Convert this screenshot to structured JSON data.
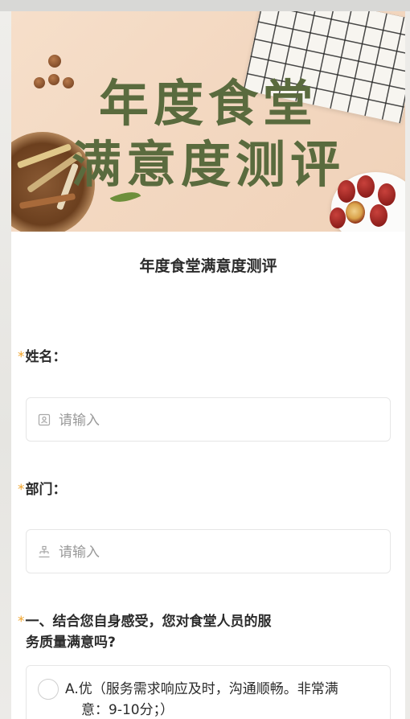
{
  "banner": {
    "title_line1": "年度食堂",
    "title_line2": "满意度测评"
  },
  "form": {
    "title": "年度食堂满意度测评",
    "required_mark": "*",
    "fields": [
      {
        "label": "姓名：",
        "placeholder": "请输入",
        "icon": "user-card-icon"
      },
      {
        "label": "部门：",
        "placeholder": "请输入",
        "icon": "org-chart-icon"
      }
    ],
    "question1": {
      "line1": "一、结合您自身感受，您对食堂人员的服",
      "line2": "务质量满意吗?",
      "option_a_line1": "A.优（服务需求响应及时，沟通顺畅。非常满",
      "option_a_line2": "意：9-10分；）"
    }
  },
  "colors": {
    "required": "#f0a32a",
    "banner_title": "#5a6b3e",
    "text": "#2b2b2b"
  }
}
